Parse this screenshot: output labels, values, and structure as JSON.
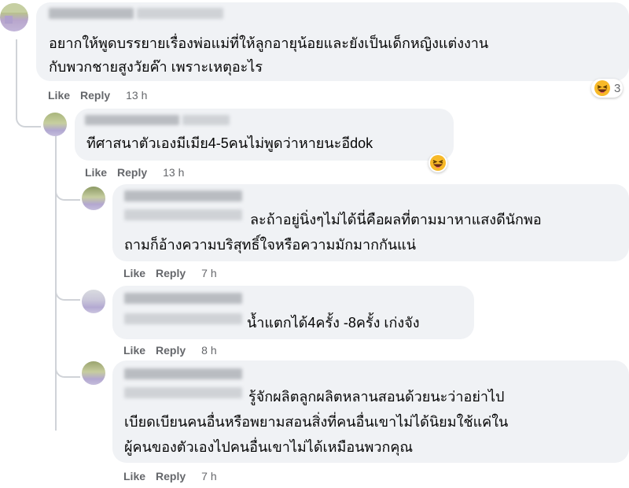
{
  "comments": [
    {
      "text_lines": [
        "อยากให้พูดบรรยายเรื่องพ่อแม่ที่ให้ลูกอายุน้อยและยังเป็นเด็กหญิงแต่งงาน",
        "กับพวกชายสูงวัยค๊า เพราะเหตุอะไร"
      ],
      "like_label": "Like",
      "reply_label": "Reply",
      "time": "13 h",
      "reaction_icon": "laughing-emoji-icon",
      "reaction_count": "3"
    },
    {
      "text_lines": [
        "ทีศาสนาตัวเองมีเมีย4-5คนไม่พูดว่าหายนะอีdok"
      ],
      "like_label": "Like",
      "reply_label": "Reply",
      "time": "13 h",
      "reaction_icon": "laughing-emoji-icon"
    },
    {
      "text_lines": [
        "ละถ้าอยู่นิ่งๆไม่ได้นี่คือผลที่ตามมาหาแสงดีนักพอ",
        "ถามก็อ้างความบริสุทธิ์ใจหรือความมักมากกันแน่"
      ],
      "like_label": "Like",
      "reply_label": "Reply",
      "time": "7 h"
    },
    {
      "text_lines": [
        "น้ำแตกได้4ครั้ง -8ครั้ง เก่งจัง"
      ],
      "like_label": "Like",
      "reply_label": "Reply",
      "time": "8 h"
    },
    {
      "text_lines": [
        "รู้จักผลิตลูกผลิตหลานสอนด้วยนะว่าอย่าไป",
        "เบียดเบียนคนอื่นหรือพยามสอนสิ่งที่คนอื่นเขาไม่ได้นิยมใช้แค่ใน",
        "ผู้คนของตัวเองไปคนอื่นเขาไม่ได้เหมือนพวกคุณ"
      ],
      "like_label": "Like",
      "reply_label": "Reply",
      "time": "7 h"
    }
  ],
  "colors": {
    "bubble": "#f0f2f5",
    "meta": "#65676b",
    "text": "#050505"
  }
}
